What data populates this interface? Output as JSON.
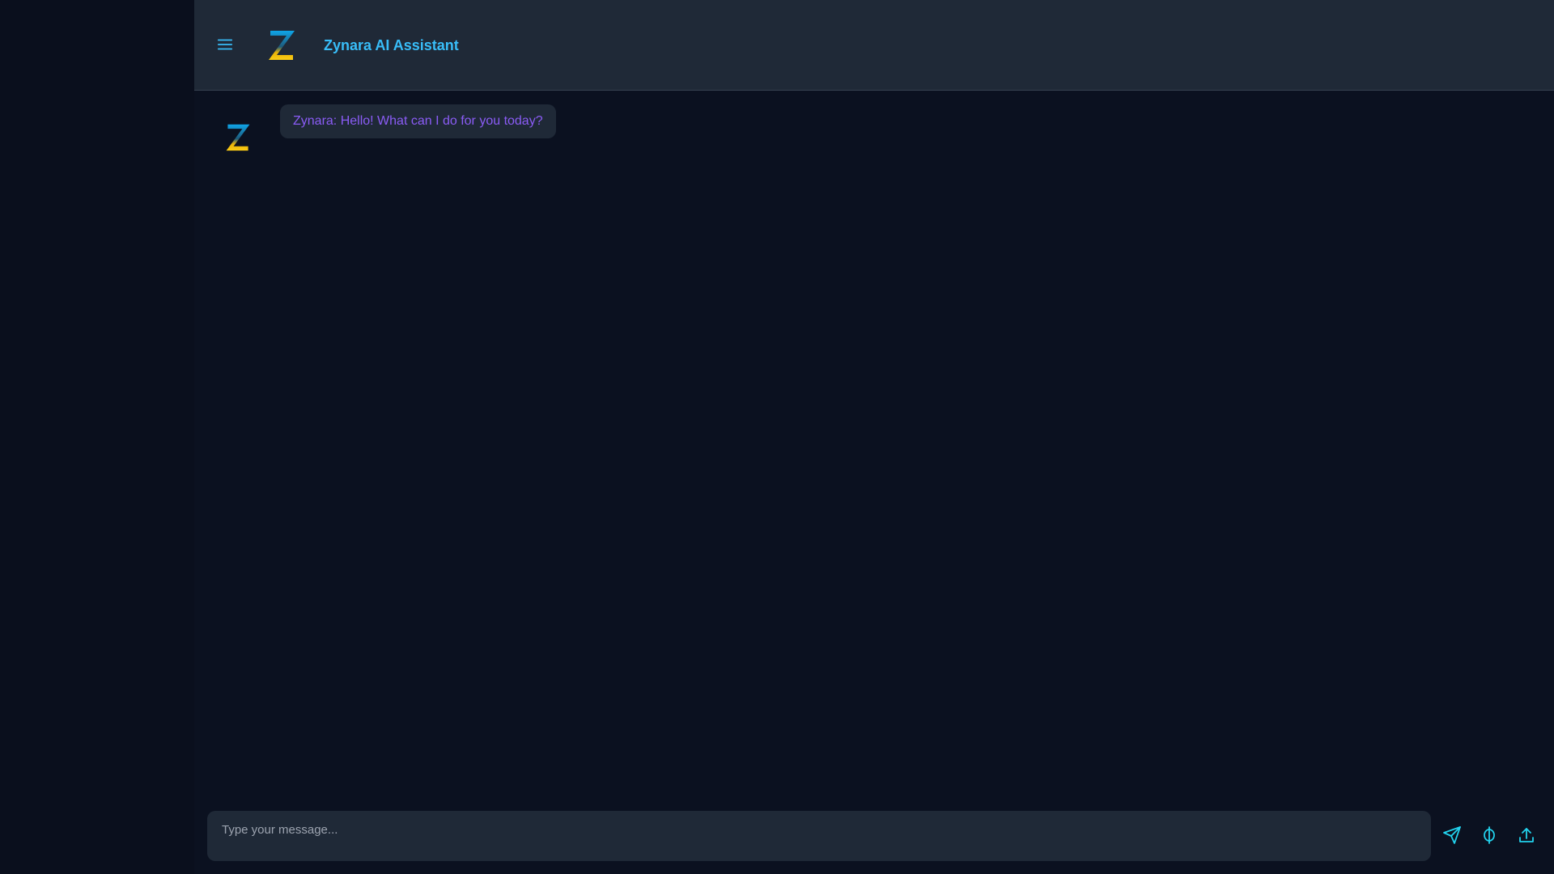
{
  "header": {
    "title": "Zynara AI Assistant",
    "menu_icon": "hamburger-menu-icon",
    "logo_icon": "zynara-logo-icon"
  },
  "messages": [
    {
      "sender": "assistant",
      "text": "Zynara: Hello! What can I do for you today?",
      "avatar_icon": "zynara-logo-icon"
    }
  ],
  "composer": {
    "placeholder": "Type your message...",
    "value": "",
    "actions": [
      {
        "name": "send",
        "icon": "send-icon"
      },
      {
        "name": "phi",
        "icon": "phi-icon"
      },
      {
        "name": "upload",
        "icon": "upload-icon"
      }
    ]
  },
  "colors": {
    "accent": "#38bdf8",
    "message_text": "#8b5cf6",
    "icon_cyan": "#22d3ee",
    "panel": "#1f2937",
    "background": "#0b1120",
    "sidebar": "#0a0f1d",
    "logo_top": "#0ea5e9",
    "logo_bottom": "#facc15"
  }
}
